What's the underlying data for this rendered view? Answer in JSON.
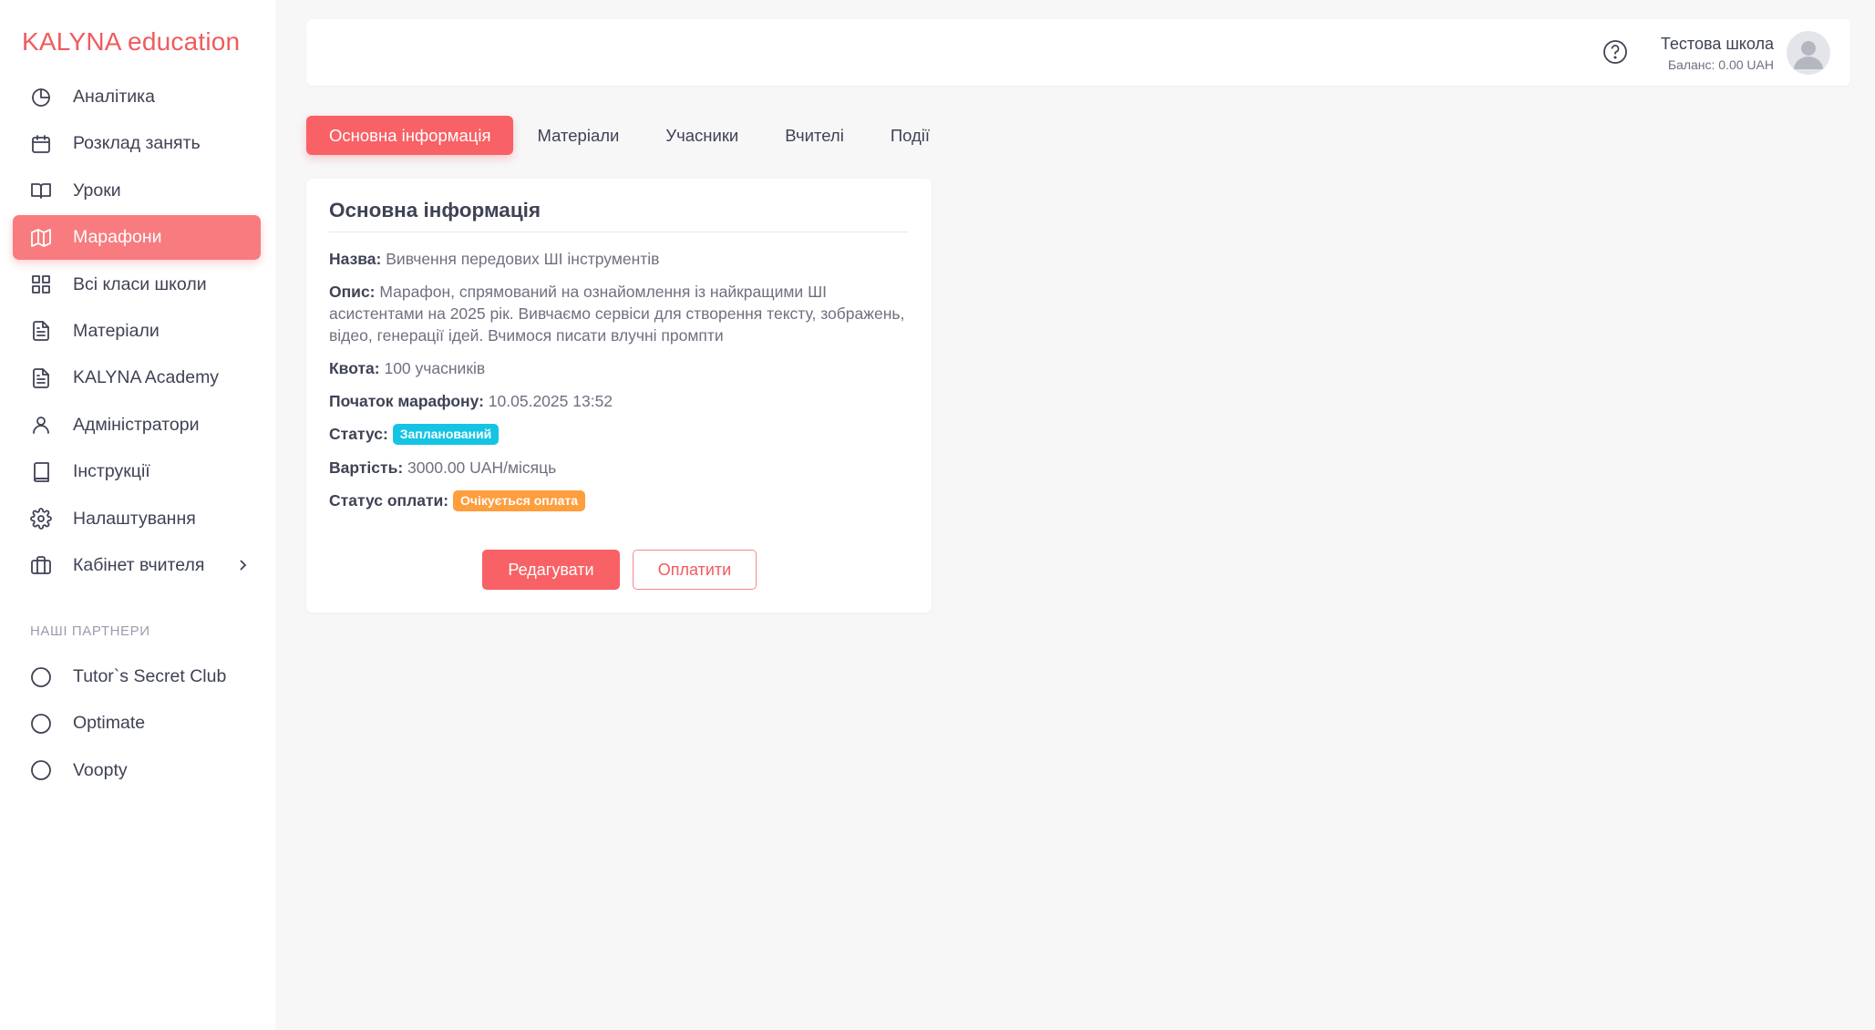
{
  "brand": "KALYNA education",
  "sidebar": {
    "items": [
      {
        "label": "Аналітика",
        "icon": "pie-chart-icon"
      },
      {
        "label": "Розклад занять",
        "icon": "calendar-icon"
      },
      {
        "label": "Уроки",
        "icon": "book-open-icon"
      },
      {
        "label": "Марафони",
        "icon": "map-icon",
        "active": true
      },
      {
        "label": "Всі класи школи",
        "icon": "grid-icon"
      },
      {
        "label": "Матеріали",
        "icon": "document-icon"
      },
      {
        "label": "KALYNA Academy",
        "icon": "document-icon"
      },
      {
        "label": "Адміністратори",
        "icon": "user-icon"
      },
      {
        "label": "Інструкції",
        "icon": "book-icon"
      },
      {
        "label": "Налаштування",
        "icon": "gear-icon"
      },
      {
        "label": "Кабінет вчителя",
        "icon": "briefcase-icon",
        "expandable": true
      }
    ],
    "partners_title": "НАШІ ПАРТНЕРИ",
    "partners": [
      {
        "label": "Tutor`s Secret Club",
        "icon": "circle-icon"
      },
      {
        "label": "Optimate",
        "icon": "circle-icon"
      },
      {
        "label": "Voopty",
        "icon": "circle-icon"
      }
    ]
  },
  "header": {
    "user_name": "Тестова школа",
    "balance": "Баланс: 0.00 UAH"
  },
  "tabs": [
    {
      "label": "Основна інформація",
      "active": true
    },
    {
      "label": "Матеріали"
    },
    {
      "label": "Учасники"
    },
    {
      "label": "Вчителі"
    },
    {
      "label": "Події"
    }
  ],
  "card": {
    "title": "Основна інформація",
    "name_label": "Назва:",
    "name_value": "Вивчення передових ШІ інструментів",
    "desc_label": "Опис:",
    "desc_value": "Марафон, спрямований на ознайомлення із найкращими ШІ асистентами на 2025 рік. Вивчаємо сервіси для створення тексту, зображень, відео, генерації ідей. Вчимося писати влучні промпти",
    "quota_label": "Квота:",
    "quota_value": "100 учасників",
    "start_label": "Початок марафону:",
    "start_value": "10.05.2025 13:52",
    "status_label": "Статус:",
    "status_value": "Запланований",
    "price_label": "Вартість:",
    "price_value": "3000.00 UAH/місяць",
    "payment_label": "Статус оплати:",
    "payment_value": "Очікується оплата",
    "edit_button": "Редагувати",
    "pay_button": "Оплатити"
  },
  "colors": {
    "accent": "#f86165",
    "active_nav": "#f87b7f",
    "status_badge": "#15c4e4",
    "payment_badge": "#ff9e3d"
  }
}
